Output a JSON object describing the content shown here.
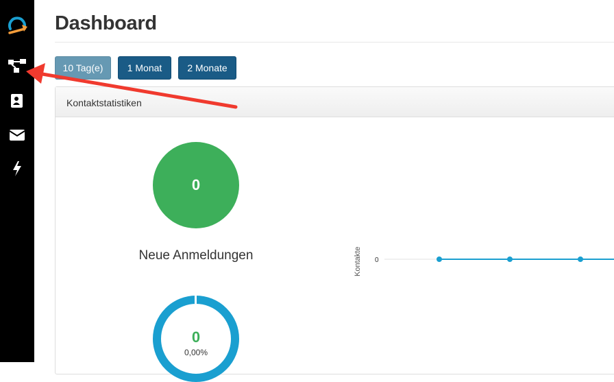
{
  "sidebar": {
    "items": [
      {
        "name": "logo-icon"
      },
      {
        "name": "segments-icon"
      },
      {
        "name": "contacts-icon"
      },
      {
        "name": "email-icon"
      },
      {
        "name": "campaign-bolt-icon"
      }
    ]
  },
  "header": {
    "title": "Dashboard"
  },
  "filters": {
    "buttons": [
      {
        "label": "10 Tag(e)",
        "active": true
      },
      {
        "label": "1 Monat",
        "active": false
      },
      {
        "label": "2 Monate",
        "active": false
      }
    ]
  },
  "panel": {
    "title": "Kontaktstatistiken",
    "new_signups": {
      "value": "0",
      "label": "Neue Anmeldungen"
    },
    "ring": {
      "value": "0",
      "percent": "0,00%"
    }
  },
  "chart_data": {
    "type": "line",
    "ylabel": "Kontakte",
    "y_ticks": [
      "0"
    ],
    "series": [
      {
        "values": [
          0,
          0,
          0
        ]
      }
    ],
    "color": "#1a9fd0"
  },
  "annotation": {
    "arrow_color": "#f03a2e"
  }
}
